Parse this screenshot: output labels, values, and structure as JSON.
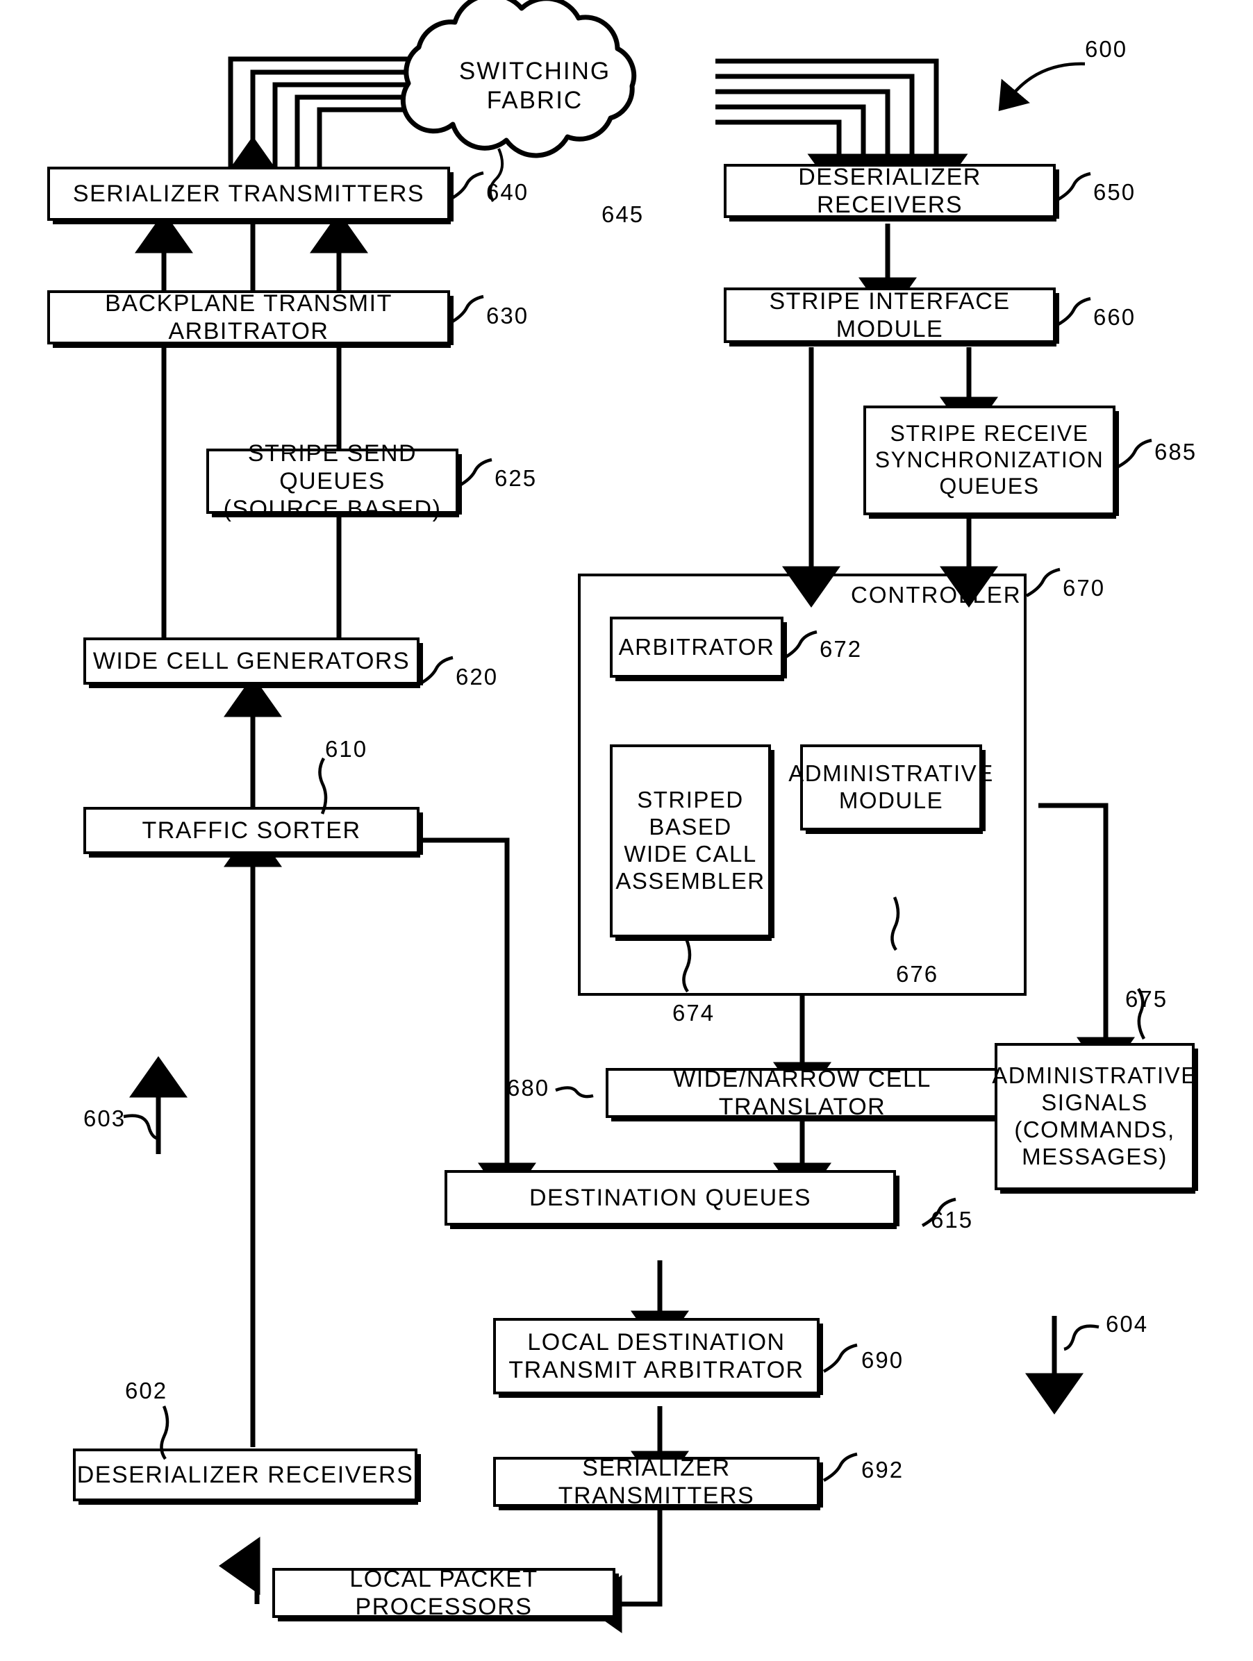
{
  "figure": {
    "reference_numeral": "600",
    "domain_note": "patent block diagram of a packet switching line card"
  },
  "cloud": {
    "label_line1": "SWITCHING",
    "label_line2": "FABRIC",
    "ref": "645"
  },
  "blocks": {
    "serializer_transmitters_top": {
      "label": "SERIALIZER TRANSMITTERS",
      "ref": "640"
    },
    "backplane_transmit_arbitrator": {
      "label": "BACKPLANE TRANSMIT ARBITRATOR",
      "ref": "630"
    },
    "stripe_send_queues": {
      "label_line1": "STRIPE SEND QUEUES",
      "label_line2": "(SOURCE BASED)",
      "ref": "625"
    },
    "wide_cell_generators": {
      "label": "WIDE CELL GENERATORS",
      "ref": "620"
    },
    "traffic_sorter": {
      "label": "TRAFFIC SORTER",
      "ref": "610"
    },
    "deserializer_receivers_bottom": {
      "label": "DESERIALIZER RECEIVERS",
      "ref": "602"
    },
    "local_packet_processors": {
      "label": "LOCAL PACKET PROCESSORS"
    },
    "deserializer_receivers_top": {
      "label": "DESERIALIZER RECEIVERS",
      "ref": "650"
    },
    "stripe_interface_module": {
      "label": "STRIPE INTERFACE MODULE",
      "ref": "660"
    },
    "stripe_receive_sync_queues": {
      "label_line1": "STRIPE RECEIVE",
      "label_line2": "SYNCHRONIZATION",
      "label_line3": "QUEUES",
      "ref": "685"
    },
    "controller": {
      "label": "CONTROLLER",
      "ref": "670"
    },
    "arbitrator": {
      "label": "ARBITRATOR",
      "ref": "672"
    },
    "striped_based_wide_call_assembler": {
      "label_line1": "STRIPED",
      "label_line2": "BASED",
      "label_line3": "WIDE CALL",
      "label_line4": "ASSEMBLER",
      "ref": "674"
    },
    "administrative_module": {
      "label_line1": "ADMINISTRATIVE",
      "label_line2": "MODULE",
      "ref": "676"
    },
    "wide_narrow_cell_translator": {
      "label": "WIDE/NARROW CELL TRANSLATOR",
      "ref": "680"
    },
    "administrative_signals": {
      "label_line1": "ADMINISTRATIVE",
      "label_line2": "SIGNALS",
      "label_line3": "(COMMANDS,",
      "label_line4": "MESSAGES)",
      "ref": "675"
    },
    "destination_queues": {
      "label": "DESTINATION QUEUES",
      "ref": "615"
    },
    "local_destination_transmit_arbitrator": {
      "label_line1": "LOCAL DESTINATION",
      "label_line2": "TRANSMIT ARBITRATOR",
      "ref": "690"
    },
    "serializer_transmitters_bottom": {
      "label": "SERIALIZER TRANSMITTERS",
      "ref": "692"
    }
  },
  "flow_markers": {
    "ingress_direction": "603",
    "egress_direction": "604"
  },
  "colors": {
    "ink": "#000000",
    "paper": "#ffffff"
  }
}
